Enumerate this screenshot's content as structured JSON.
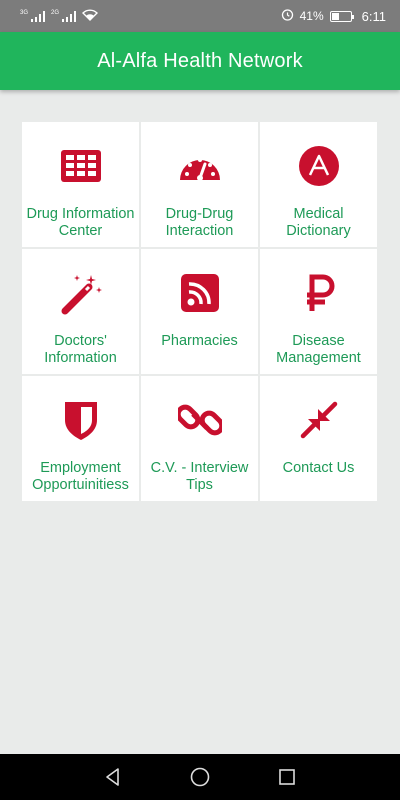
{
  "status_bar": {
    "sim1_label": "3G",
    "sim2_label": "2G",
    "battery_percent": "41%",
    "battery_level": 0.41,
    "time": "6:11",
    "icons": [
      "signal-icon",
      "signal-icon",
      "wifi-icon",
      "alarm-icon",
      "battery-icon"
    ]
  },
  "app_bar": {
    "title": "Al-Alfa Health Network",
    "color": "#20b55c"
  },
  "accent_color": "#c8102e",
  "label_color": "#1e9a57",
  "tiles": [
    {
      "label": "Drug Information\nCenter",
      "icon": "table-icon"
    },
    {
      "label": "Drug-Drug\nInteraction",
      "icon": "dashboard-icon"
    },
    {
      "label": "Medical\nDictionary",
      "icon": "letter-a-icon"
    },
    {
      "label": "Doctors'\nInformation",
      "icon": "magic-wand-icon"
    },
    {
      "label": "Pharmacies",
      "icon": "rss-icon"
    },
    {
      "label": "Disease\nManagement",
      "icon": "ruble-icon"
    },
    {
      "label": "Employment\nOpportuinitiess",
      "icon": "shield-icon"
    },
    {
      "label": "C.V. - Interview\nTips",
      "icon": "chain-link-icon"
    },
    {
      "label": "Contact Us",
      "icon": "compress-icon"
    }
  ],
  "nav_bar": {
    "icons": [
      "back-icon",
      "home-icon",
      "recents-icon"
    ]
  }
}
